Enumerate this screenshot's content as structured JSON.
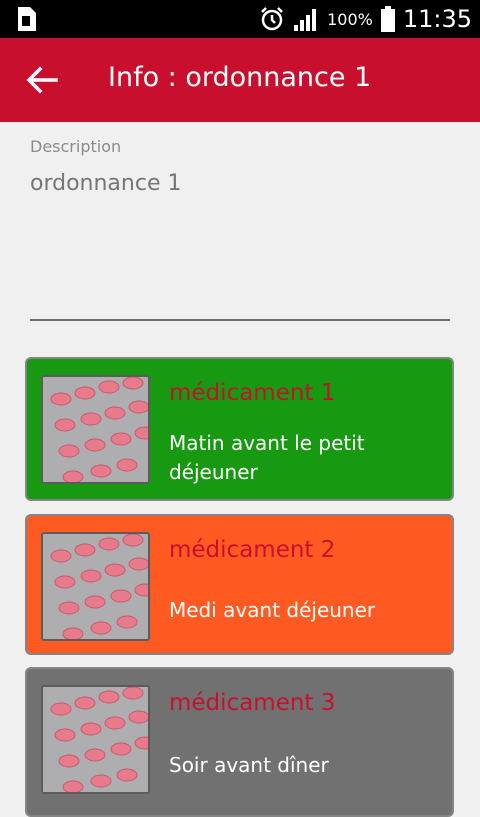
{
  "status_bar": {
    "battery_percent": "100%",
    "time": "11:35",
    "icons": [
      "sim-card-icon",
      "alarm-icon",
      "signal-icon",
      "battery-icon"
    ]
  },
  "toolbar": {
    "title": "Info : ordonnance 1",
    "back_icon": "arrow-left-icon"
  },
  "description": {
    "label": "Description",
    "value": "ordonnance 1"
  },
  "medications": [
    {
      "name": "médicament 1",
      "instruction": "Matin avant le petit déjeuner",
      "color": "#179a12"
    },
    {
      "name": "médicament 2",
      "instruction": "Medi avant déjeuner",
      "color": "#ff5a22"
    },
    {
      "name": "médicament 3",
      "instruction": "Soir avant dîner",
      "color": "#717171"
    }
  ],
  "colors": {
    "accent": "#c8102e",
    "background": "#f0f0f0"
  }
}
